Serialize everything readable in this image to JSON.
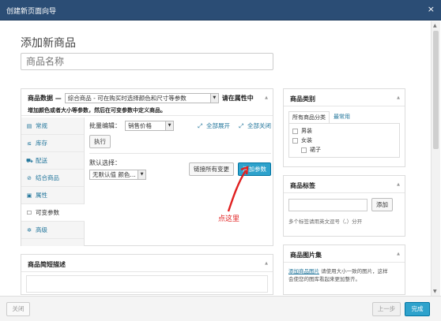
{
  "window": {
    "title": "创建新页面向导",
    "close_symbol": "×"
  },
  "page": {
    "title": "添加新商品",
    "name_placeholder": "商品名称"
  },
  "product_data": {
    "heading": "商品数据 —",
    "type_select": "综合商品 - 可在购买时选择颜色和尺寸等参数",
    "type_note": "请在属性中",
    "note_line2": "增加颜色或者大小等参数，然后在可变参数中定义商品。",
    "tabs": [
      {
        "icon": "▤",
        "label": "常规"
      },
      {
        "icon": "≤",
        "label": "库存"
      },
      {
        "icon": "⛟",
        "label": "配送"
      },
      {
        "icon": "⊘",
        "label": "结合商品"
      },
      {
        "icon": "▣",
        "label": "属性"
      },
      {
        "icon": "☐",
        "label": "可变参数"
      },
      {
        "icon": "✲",
        "label": "高级"
      }
    ],
    "bulk_label": "批量编辑：",
    "bulk_select": "销售价格",
    "expand_all": "全部展开",
    "close_all": "全部关闭",
    "run_button": "执行",
    "default_label": "默认选择：",
    "default_select": "无默认值 颜色…",
    "link_all_button": "链接所有变更",
    "add_variation_button": "添加参数"
  },
  "annotation": {
    "text": "点这里"
  },
  "short_desc": {
    "heading": "商品简短描述"
  },
  "category_box": {
    "heading": "商品类别",
    "tab_all": "所有商品分类",
    "tab_common": "最常用",
    "items": [
      "男装",
      "女装",
      "裙子"
    ]
  },
  "tag_box": {
    "heading": "商品标签",
    "add_button": "添加",
    "hint": "多个标签请用英文逗号（,）分开"
  },
  "gallery_box": {
    "heading": "商品图片集",
    "link": "添加商品图片",
    "text1": "请使用大小一致的图片，这样",
    "text2": "会使您的图库看起来更加整齐。"
  },
  "footer": {
    "close": "关闭",
    "prev": "上一步",
    "done": "完成"
  }
}
